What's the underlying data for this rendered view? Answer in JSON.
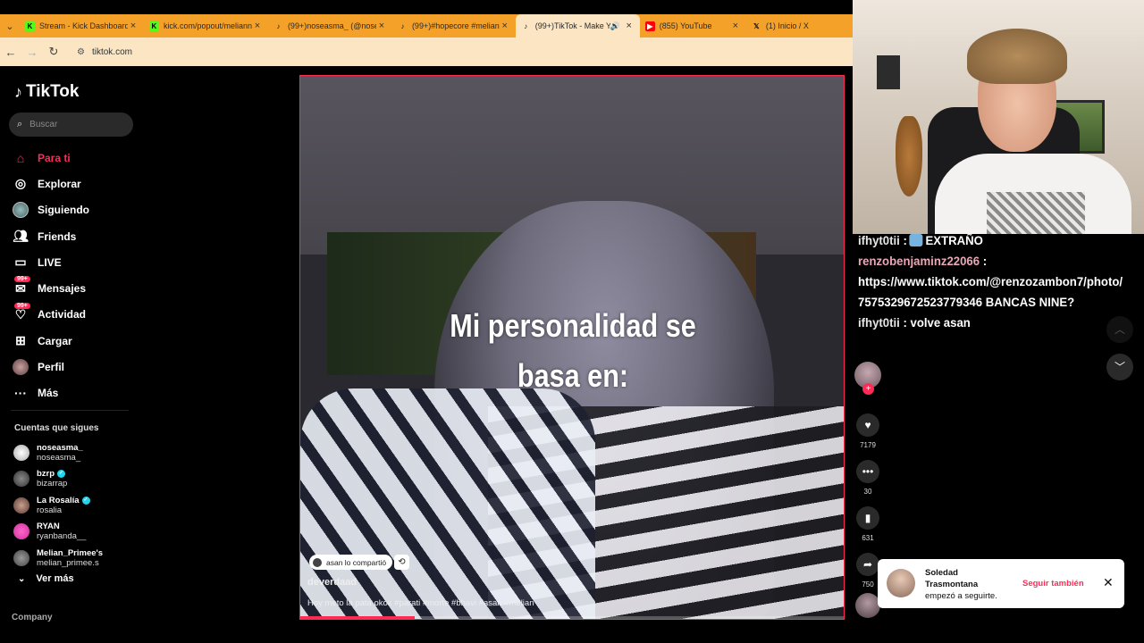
{
  "browser": {
    "tabs": [
      {
        "title": "Stream - Kick Dashboard",
        "favicon": "kick-icon",
        "active": false
      },
      {
        "title": "kick.com/popout/meliann",
        "favicon": "kick-icon",
        "active": false
      },
      {
        "title": "(99+)noseasma_ (@noseasma",
        "favicon": "tiktok-icon",
        "active": false
      },
      {
        "title": "(99+)#hopecore #melian",
        "favicon": "tiktok-icon",
        "active": false
      },
      {
        "title": "(99+)TikTok - Make Yo",
        "favicon": "tiktok-icon",
        "active": true
      },
      {
        "title": "(855) YouTube",
        "favicon": "youtube-icon",
        "active": false
      },
      {
        "title": "(1) Inicio / X",
        "favicon": "x-icon",
        "active": false
      }
    ],
    "url": "tiktok.com"
  },
  "sidebar": {
    "logo": "TikTok",
    "search_placeholder": "Buscar",
    "menu": [
      {
        "label": "Para ti",
        "icon": "home-icon"
      },
      {
        "label": "Explorar",
        "icon": "compass-icon"
      },
      {
        "label": "Siguiendo",
        "icon": "following-avatar-icon"
      },
      {
        "label": "Friends",
        "icon": "friends-icon"
      },
      {
        "label": "LIVE",
        "icon": "live-icon"
      },
      {
        "label": "Mensajes",
        "icon": "messages-icon",
        "badge": "99+"
      },
      {
        "label": "Actividad",
        "icon": "activity-icon",
        "badge": "99+"
      },
      {
        "label": "Cargar",
        "icon": "upload-icon"
      },
      {
        "label": "Perfil",
        "icon": "profile-avatar-icon"
      },
      {
        "label": "Más",
        "icon": "more-icon"
      }
    ],
    "following_title": "Cuentas que sigues",
    "following": [
      {
        "name": "noseasma_",
        "handle": "noseasma_",
        "verified": false
      },
      {
        "name": "bzrp",
        "handle": "bizarrap",
        "verified": true
      },
      {
        "name": "La Rosalía",
        "handle": "rosalia",
        "verified": true
      },
      {
        "name": "RYAN",
        "handle": "ryanbanda__",
        "verified": false
      },
      {
        "name": "Melian_Primee's",
        "handle": "melian_primee.s",
        "verified": false
      }
    ],
    "see_more": "Ver más",
    "company": "Company"
  },
  "video": {
    "caption_line1": "Mi personalidad se",
    "caption_line2": "basa en:",
    "shared_by": "asan lo compartió",
    "author": "deverdaad",
    "description": "Hoy meto la pata okok #parati #morte #bhavi #asan #melian",
    "progress": 0.21
  },
  "actions": {
    "likes": "7179",
    "comments": "30",
    "saves": "631",
    "shares": "750"
  },
  "chat": [
    {
      "user": "ifhyt0tii",
      "text": "EXTRAÑO",
      "emoji": true
    },
    {
      "user": "renzobenjaminz22066",
      "text": "https://www.tiktok.com/@renzozambon7/photo/7575329672523779346 BANCAS NINE?"
    },
    {
      "user": "ifhyt0tii",
      "text": "volve asan"
    }
  ],
  "notification": {
    "name": "Soledad Trasmontana",
    "action": "empezó a seguirte.",
    "button": "Seguir también"
  },
  "colors": {
    "accent": "#fe2c55",
    "tab_bar": "#f4a12a"
  }
}
